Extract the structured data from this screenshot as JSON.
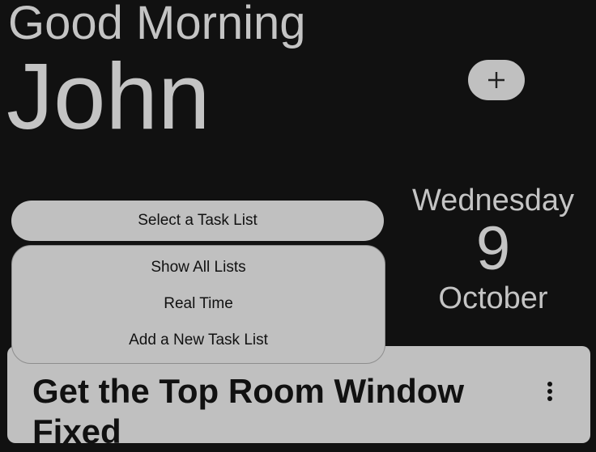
{
  "header": {
    "greeting": "Good Morning",
    "user_name": "John"
  },
  "add_button": {
    "icon": "plus-icon"
  },
  "date": {
    "weekday": "Wednesday",
    "day": "9",
    "month": "October"
  },
  "task_list_selector": {
    "label": "Select a Task List",
    "options": [
      "Show All Lists",
      "Real Time",
      "Add a New Task List"
    ]
  },
  "task_card": {
    "title": "Get the Top Room Window Fixed",
    "menu_icon": "more-vertical-icon"
  },
  "colors": {
    "background": "#111111",
    "surface": "#c0c0c0",
    "text_light": "#c4c4c4",
    "text_dark": "#111111"
  }
}
